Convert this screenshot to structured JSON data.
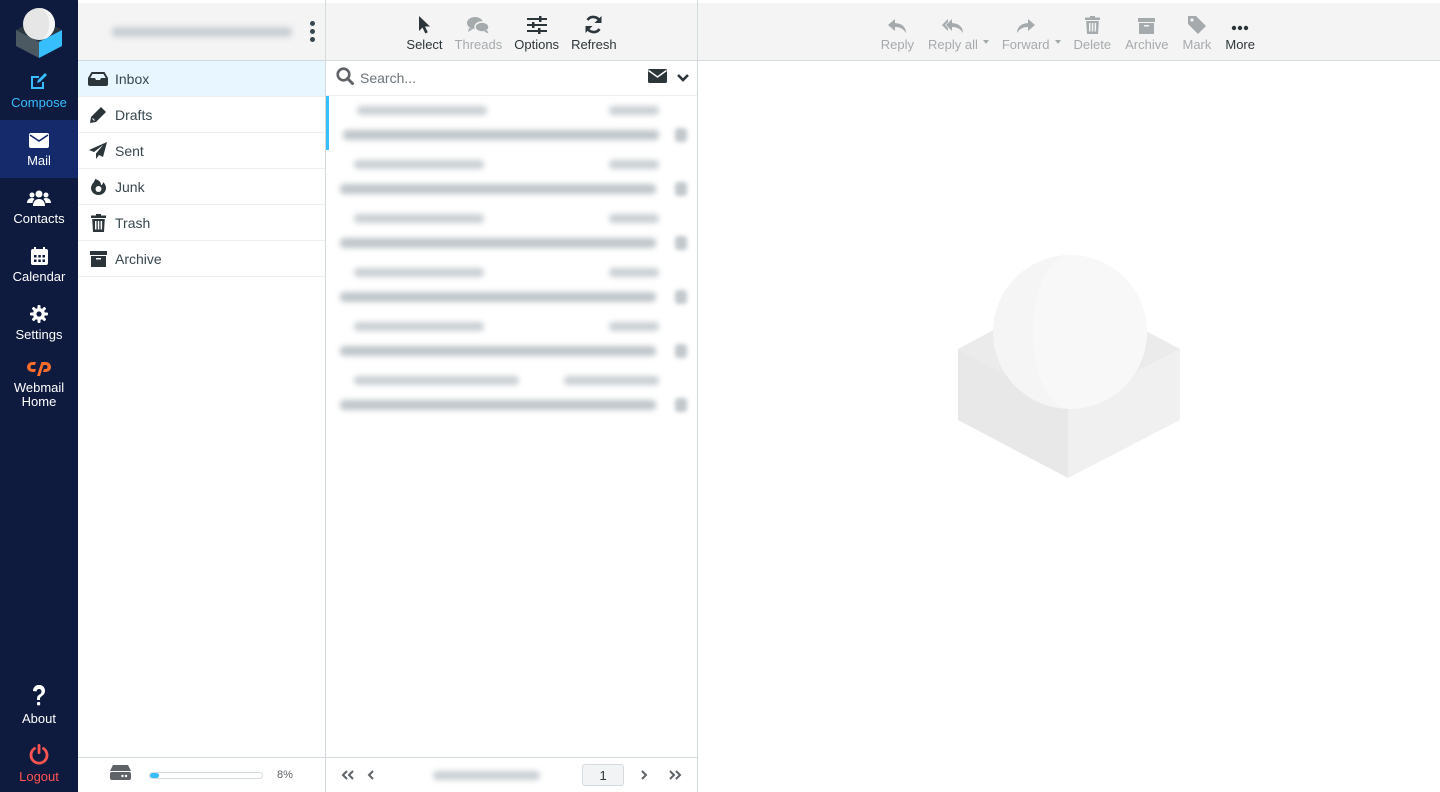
{
  "nav": {
    "logo": "roundcube-logo",
    "items": [
      {
        "label": "Compose",
        "icon": "compose-icon"
      },
      {
        "label": "Mail",
        "icon": "envelope-icon",
        "active": true
      },
      {
        "label": "Contacts",
        "icon": "users-icon"
      },
      {
        "label": "Calendar",
        "icon": "calendar-icon"
      },
      {
        "label": "Settings",
        "icon": "gear-icon"
      },
      {
        "label": "Webmail Home",
        "icon": "cpanel-icon"
      }
    ],
    "bottom": [
      {
        "label": "About",
        "icon": "question-icon"
      },
      {
        "label": "Logout",
        "icon": "power-icon"
      }
    ],
    "colors": {
      "background": "#0e1a3e",
      "active": "#152a6b",
      "compose": "#37beff",
      "logout": "#ff5552",
      "cpanel": "#ff6c2c"
    }
  },
  "folders": {
    "account_email_redacted": true,
    "items": [
      {
        "label": "Inbox",
        "icon": "inbox-icon",
        "selected": true
      },
      {
        "label": "Drafts",
        "icon": "pencil-icon"
      },
      {
        "label": "Sent",
        "icon": "paper-plane-icon"
      },
      {
        "label": "Junk",
        "icon": "fire-icon"
      },
      {
        "label": "Trash",
        "icon": "trash-icon"
      },
      {
        "label": "Archive",
        "icon": "archive-icon"
      }
    ],
    "quota": {
      "percent_label": "8%",
      "fraction": 0.08,
      "icon": "hard-drive-icon"
    }
  },
  "list_toolbar": {
    "buttons": [
      {
        "label": "Select",
        "icon": "cursor-icon",
        "enabled": true
      },
      {
        "label": "Threads",
        "icon": "comments-icon",
        "enabled": false
      },
      {
        "label": "Options",
        "icon": "sliders-icon",
        "enabled": true
      },
      {
        "label": "Refresh",
        "icon": "refresh-icon",
        "enabled": true
      }
    ]
  },
  "search": {
    "placeholder": "Search...",
    "value": ""
  },
  "messages": {
    "count": 6,
    "redacted": true
  },
  "pager": {
    "current_page": "1",
    "count_label_redacted": true
  },
  "message_toolbar": {
    "buttons": [
      {
        "label": "Reply",
        "icon": "reply-icon",
        "enabled": false
      },
      {
        "label": "Reply all",
        "icon": "reply-all-icon",
        "enabled": false,
        "dropdown": true
      },
      {
        "label": "Forward",
        "icon": "forward-icon",
        "enabled": false,
        "dropdown": true
      },
      {
        "label": "Delete",
        "icon": "trash-icon",
        "enabled": false
      },
      {
        "label": "Archive",
        "icon": "archive-icon",
        "enabled": false
      },
      {
        "label": "Mark",
        "icon": "tag-icon",
        "enabled": false
      },
      {
        "label": "More",
        "icon": "ellipsis-icon",
        "enabled": true
      }
    ]
  }
}
